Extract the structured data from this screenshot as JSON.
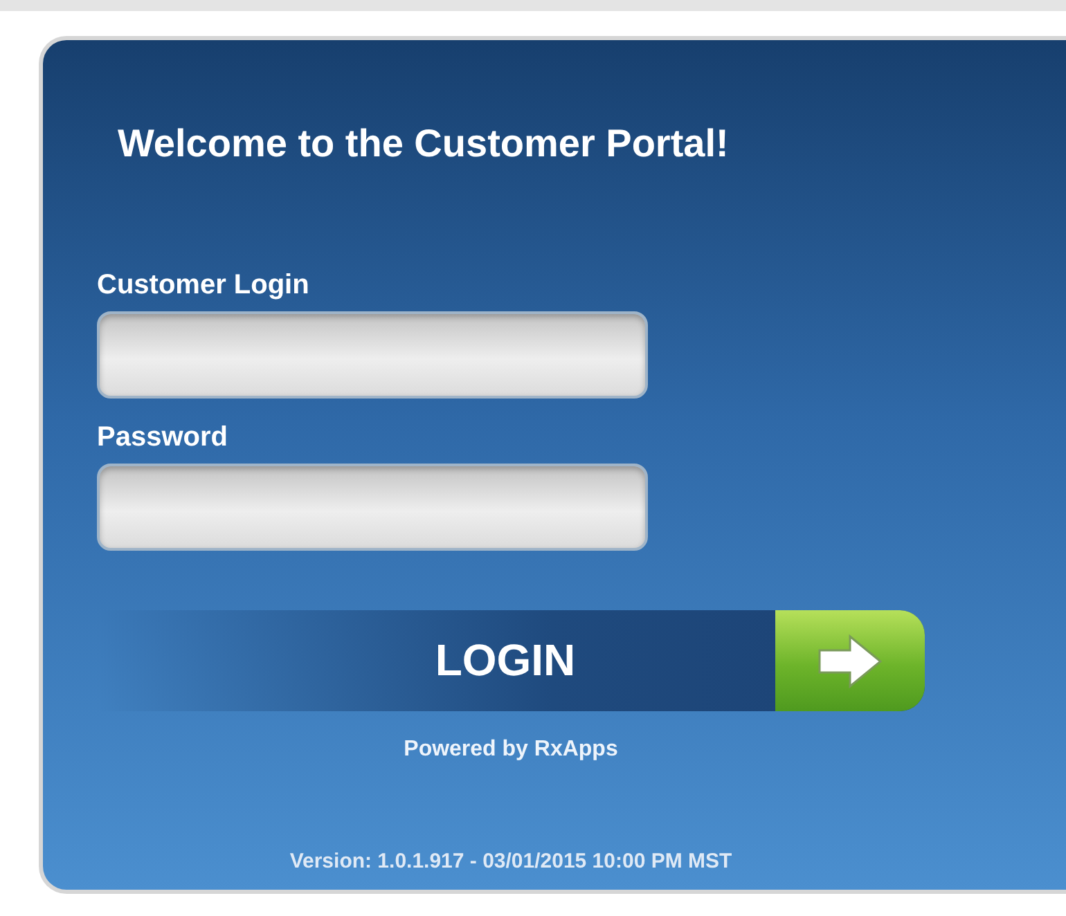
{
  "title": "Welcome to the Customer Portal!",
  "fields": [
    {
      "label": "Customer Login"
    },
    {
      "label": "Password"
    }
  ],
  "login_button": {
    "label": "LOGIN"
  },
  "powered_by": "Powered by RxApps",
  "version": "Version: 1.0.1.917 - 03/01/2015 10:00 PM MST"
}
